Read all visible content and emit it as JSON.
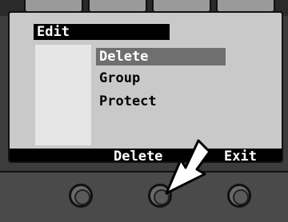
{
  "menu": {
    "title": "Edit",
    "items": [
      {
        "label": "Delete",
        "selected": true
      },
      {
        "label": "Group",
        "selected": false
      },
      {
        "label": "Protect",
        "selected": false
      }
    ]
  },
  "softkeys": {
    "left_label": "Delete",
    "right_label": "Exit"
  },
  "colors": {
    "screen_bg": "#c9c9c9",
    "selection": "#6f6f6f",
    "bar": "#000000"
  }
}
